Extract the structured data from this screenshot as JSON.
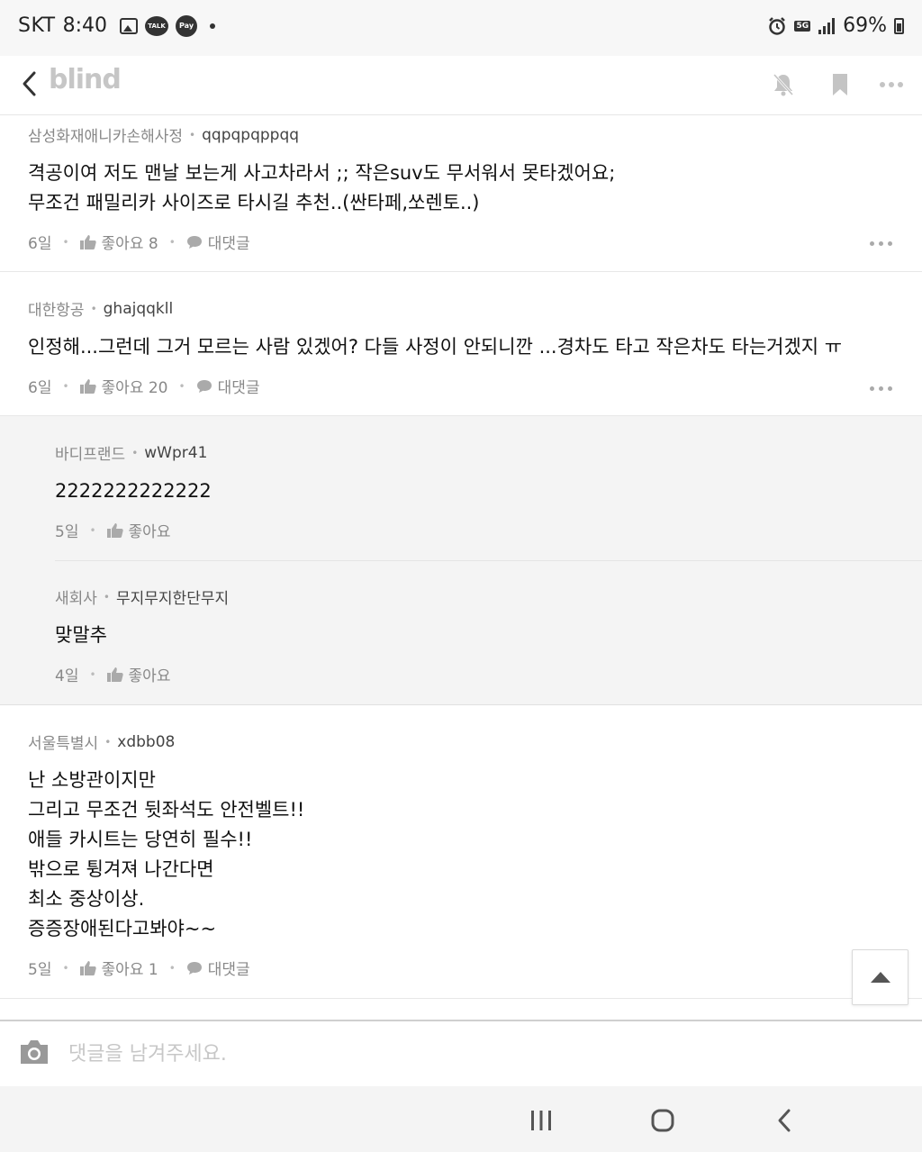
{
  "status_bar": {
    "carrier": "SKT",
    "time": "8:40",
    "notif_icons": [
      "image-icon",
      "kakaotalk-icon",
      "kakaopay-icon"
    ],
    "talk_label": "TALK",
    "pay_label": "Pay",
    "network": "5G",
    "battery": "69%"
  },
  "header": {
    "logo": "blind",
    "icons": [
      "bell-off-icon",
      "bookmark-icon",
      "more-icon"
    ]
  },
  "comments": [
    {
      "company": "삼성화재애니카손해사정",
      "nickname": "qqpqpqppqq",
      "text": "격공이여 저도 맨날 보는게 사고차라서 ;; 작은suv도 무서워서 못타겠어요;\n무조건 패밀리카 사이즈로 타시길 추천..(싼타페,쏘렌토..)",
      "age": "6일",
      "like_label": "좋아요 8",
      "reply_label": "대댓글"
    },
    {
      "company": "대한항공",
      "nickname": "ghajqqkll",
      "text": "인정해...그런데 그거 모르는 사람 있겠어? 다들 사정이 안되니깐 ...경차도 타고 작은차도 타는거겠지 ㅠ",
      "age": "6일",
      "like_label": "좋아요 20",
      "reply_label": "대댓글"
    },
    {
      "company": "바디프랜드",
      "nickname": "wWpr41",
      "text": "2222222222222",
      "age": "5일",
      "like_label": "좋아요"
    },
    {
      "company": "새회사",
      "nickname": "무지무지한단무지",
      "text": "맞말추",
      "age": "4일",
      "like_label": "좋아요"
    },
    {
      "company": "서울특별시",
      "nickname": "xdbb08",
      "text": "난 소방관이지만\n그리고 무조건 뒷좌석도 안전벨트!!\n애들 카시트는 당연히 필수!!\n밖으로 튕겨져 나간다면\n최소 중상이상.\n증증장애된다고봐야~~",
      "age": "5일",
      "like_label": "좋아요 1",
      "reply_label": "대댓글"
    }
  ],
  "input": {
    "placeholder": "댓글을 남겨주세요."
  },
  "nav": [
    "recents-icon",
    "home-icon",
    "back-icon"
  ]
}
